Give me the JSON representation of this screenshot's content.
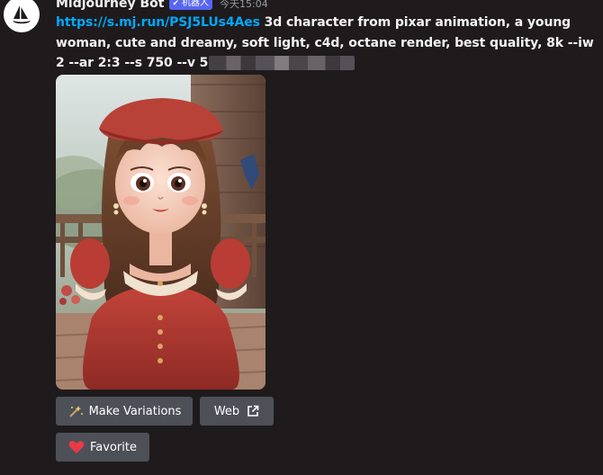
{
  "message": {
    "author": "Midjourney Bot",
    "bot_tag": "机器人",
    "timestamp": "今天15:04",
    "link_text": "https://s.mj.run/PSJ5LUs4Aes",
    "prompt_text": " 3d character from pixar animation, a young woman, cute and dreamy, soft light, c4d, octane render, best quality, 8k --iw 2 --ar 2:3 --s 750 --v 5",
    "attachment": {
      "description": "generated image"
    }
  },
  "buttons": {
    "variations": {
      "label": "Make Variations",
      "icon": "magic-wand-icon"
    },
    "web": {
      "label": "Web",
      "icon": "external-link-icon"
    },
    "favorite": {
      "label": "Favorite",
      "icon": "heart-icon"
    }
  },
  "colors": {
    "background": "#1f1b1d",
    "link": "#00a8fc",
    "button": "#4e5058",
    "bot_tag": "#5865f2",
    "heart": "#e83b46"
  }
}
